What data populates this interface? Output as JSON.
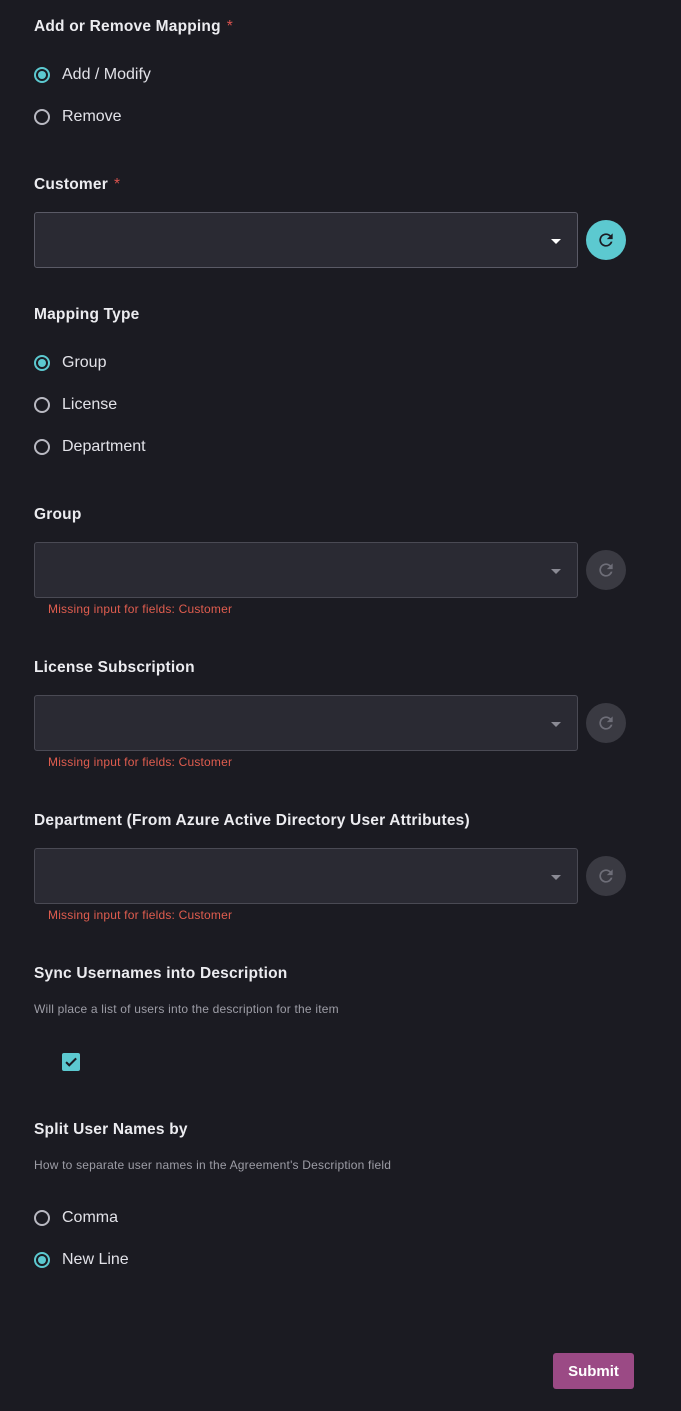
{
  "add_remove": {
    "label": "Add or Remove Mapping",
    "required_mark": "*",
    "options": [
      {
        "label": "Add / Modify",
        "selected": true
      },
      {
        "label": "Remove",
        "selected": false
      }
    ]
  },
  "customer": {
    "label": "Customer",
    "required_mark": "*",
    "value": "",
    "refresh_icon": "refresh-icon"
  },
  "mapping_type": {
    "label": "Mapping Type",
    "options": [
      {
        "label": "Group",
        "selected": true
      },
      {
        "label": "License",
        "selected": false
      },
      {
        "label": "Department",
        "selected": false
      }
    ]
  },
  "group": {
    "label": "Group",
    "value": "",
    "error": "Missing input for fields: Customer"
  },
  "license": {
    "label": "License Subscription",
    "value": "",
    "error": "Missing input for fields: Customer"
  },
  "department": {
    "label": "Department (From Azure Active Directory User Attributes)",
    "value": "",
    "error": "Missing input for fields: Customer"
  },
  "sync": {
    "label": "Sync Usernames into Description",
    "help": "Will place a list of users into the description for the item",
    "checked": true
  },
  "split": {
    "label": "Split User Names by",
    "help": "How to separate user names in the Agreement's Description field",
    "options": [
      {
        "label": "Comma",
        "selected": false
      },
      {
        "label": "New Line",
        "selected": true
      }
    ]
  },
  "submit_label": "Submit",
  "colors": {
    "background": "#1b1b22",
    "accent": "#5cc9d0",
    "error": "#e05d4f",
    "submit": "#9b4a85"
  }
}
